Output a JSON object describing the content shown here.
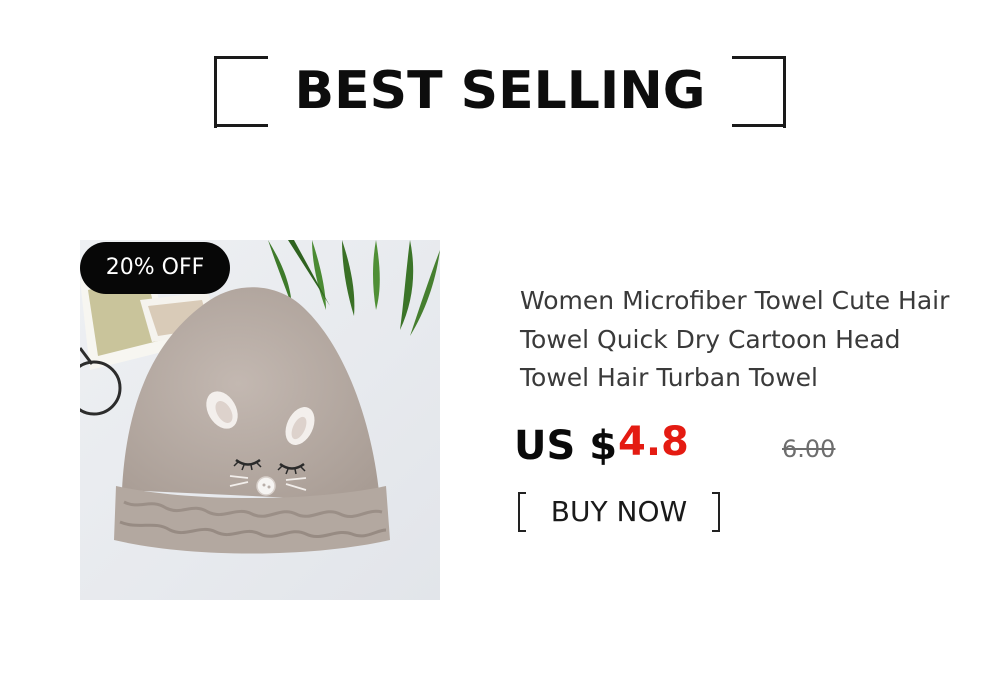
{
  "header": {
    "title": "BEST SELLING"
  },
  "product": {
    "badge": "20% OFF",
    "name": "Women Microfiber Towel Cute Hair Towel Quick Dry Cartoon Head Towel Hair Turban Towel",
    "price_prefix": "US $",
    "price": "4.8",
    "original_price": "6.00",
    "cta": "BUY NOW",
    "image_alt_icon": "hair-towel-cap-image"
  },
  "colors": {
    "price": "#e41b12",
    "badge_bg": "#070707",
    "towel": "#b7aca5"
  }
}
